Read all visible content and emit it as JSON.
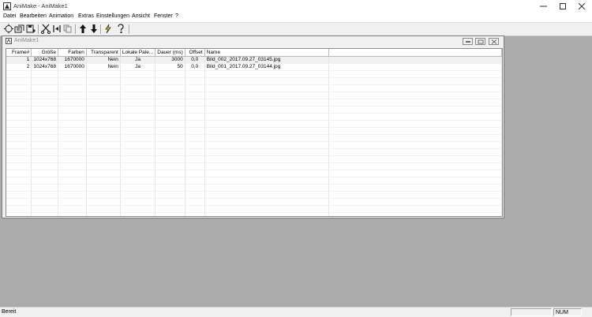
{
  "window": {
    "title": "AniMake - AniMake1"
  },
  "menu": [
    "Datei",
    "Bearbeiten",
    "Animation",
    "Extras",
    "Einstellungen",
    "Ansicht",
    "Fenster",
    "?"
  ],
  "toolbar": {
    "buttons": [
      "insert-frame-icon",
      "open-icon",
      "save-icon",
      "cut-icon",
      "properties-icon",
      "copy-icon",
      "move-up-icon",
      "move-down-icon",
      "play-icon",
      "help-icon"
    ]
  },
  "document": {
    "title": "AniMake1",
    "columns": [
      "Frame#",
      "Größe",
      "Farben",
      "Transparent",
      "Lokale Pale...",
      "Dauer (ms)",
      "Offset",
      "Name"
    ],
    "rows": [
      [
        "1",
        "1024x768",
        "1670000",
        "Nein",
        "Ja",
        "3000",
        "0,0",
        "Bild_002_2017.09.27_03145.jpg"
      ],
      [
        "2",
        "1024x768",
        "1670000",
        "Nein",
        "Ja",
        "50",
        "0,0",
        "Bild_001_2017.09.27_03144.jpg"
      ]
    ]
  },
  "status": {
    "text": "Bereit",
    "num": "NUM"
  }
}
